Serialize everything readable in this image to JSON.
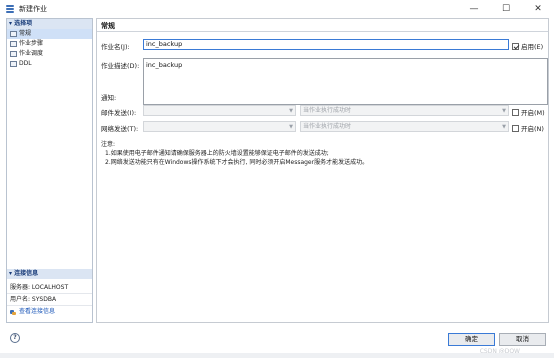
{
  "window": {
    "title": "新建作业",
    "controls": [
      "—",
      "☐",
      "✕"
    ]
  },
  "sidebar": {
    "header": "▾ 选择项",
    "items": [
      {
        "label": "常规",
        "selected": true
      },
      {
        "label": "作业步骤",
        "selected": false
      },
      {
        "label": "作业调度",
        "selected": false
      },
      {
        "label": "DDL",
        "selected": false
      }
    ],
    "connection": {
      "header": "▾ 连接信息",
      "server": "服务器: LOCALHOST",
      "user": "用户名: SYSDBA",
      "link": "查看连接信息"
    }
  },
  "main": {
    "section_title": "常规",
    "job_name_label": "作业名(J):",
    "job_name_value": "inc_backup",
    "enabled_label": "启用(E)",
    "enabled_checked": true,
    "job_desc_label": "作业描述(D):",
    "job_desc_value": "inc_backup",
    "notify_label": "通知:",
    "mail": {
      "label": "邮件发送(I):",
      "select1": "",
      "select2": "当作业执行成功时",
      "open_label": "开启(M)"
    },
    "net": {
      "label": "网络发送(T):",
      "select1": "",
      "select2": "当作业执行成功时",
      "open_label": "开启(N)"
    },
    "notes_title": "注意:",
    "notes": [
      "1.如果使用电子邮件通知请确保服务器上的防火墙设置能够保证电子邮件的发送成功;",
      "2.网络发送功能只有在Windows操作系统下才会执行, 同时必须开启Messager服务才能发送成功。"
    ]
  },
  "footer": {
    "help_glyph": "?",
    "ok_label": "确定",
    "cancel_label": "取消",
    "watermark": "CSDN @DQW"
  }
}
